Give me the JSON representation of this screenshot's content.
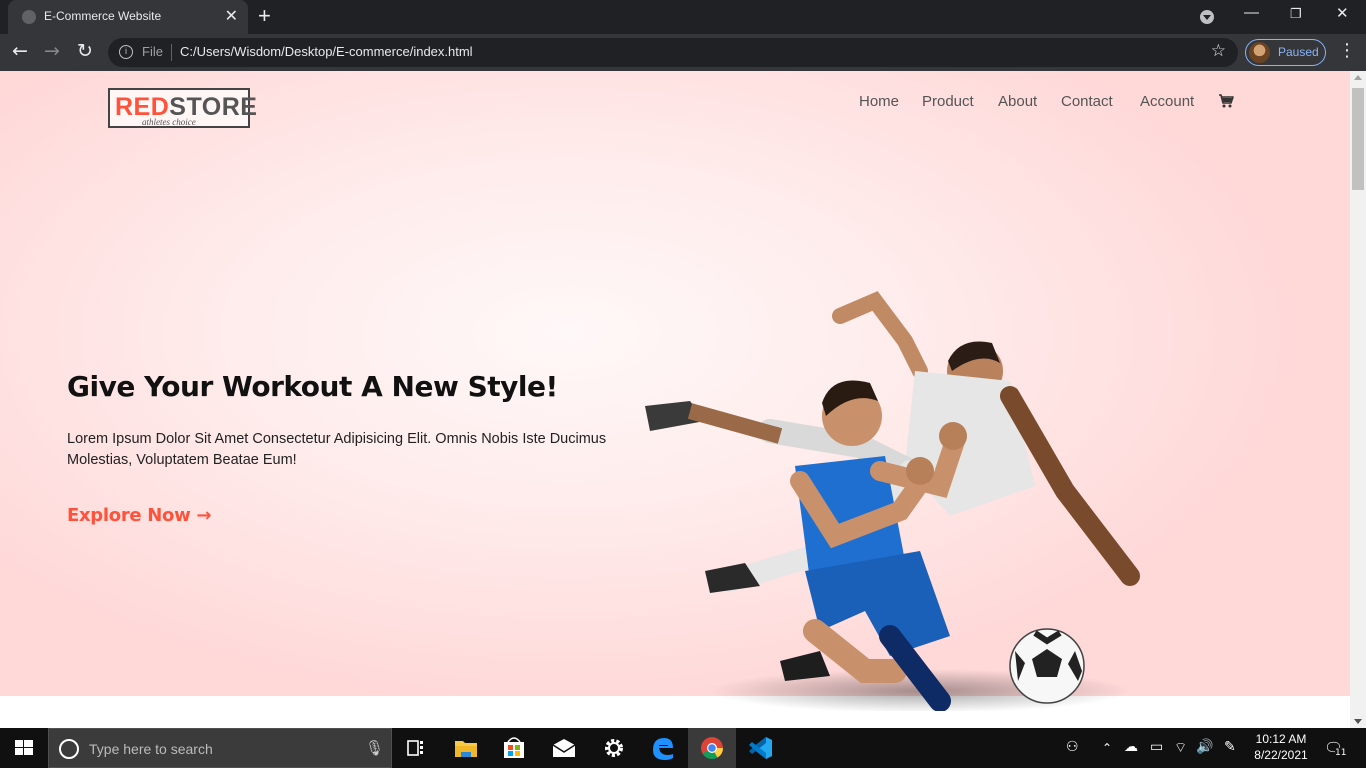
{
  "browser": {
    "tab_title": "E-Commerce Website",
    "url_scheme": "File",
    "url": "C:/Users/Wisdom/Desktop/E-commerce/index.html",
    "profile_status": "Paused"
  },
  "site": {
    "logo": {
      "word_red": "RED",
      "word_dark": "STORE",
      "tagline": "athletes choice"
    },
    "nav": [
      "Home",
      "Product",
      "About",
      "Contact",
      "Account"
    ],
    "hero": {
      "headline": "Give Your Workout A New Style!",
      "lead": "Lorem Ipsum Dolor Sit Amet Consectetur Adipisicing Elit. Omnis Nobis Iste Ducimus Molestias, Voluptatem Beatae Eum!",
      "cta": "Explore Now →"
    }
  },
  "taskbar": {
    "search_placeholder": "Type here to search",
    "time": "10:12 AM",
    "date": "8/22/2021",
    "notification_count": "11"
  },
  "colors": {
    "accent": "#ff523b",
    "hero_bg": "#ffd8d8",
    "chrome_dark": "#202124"
  }
}
